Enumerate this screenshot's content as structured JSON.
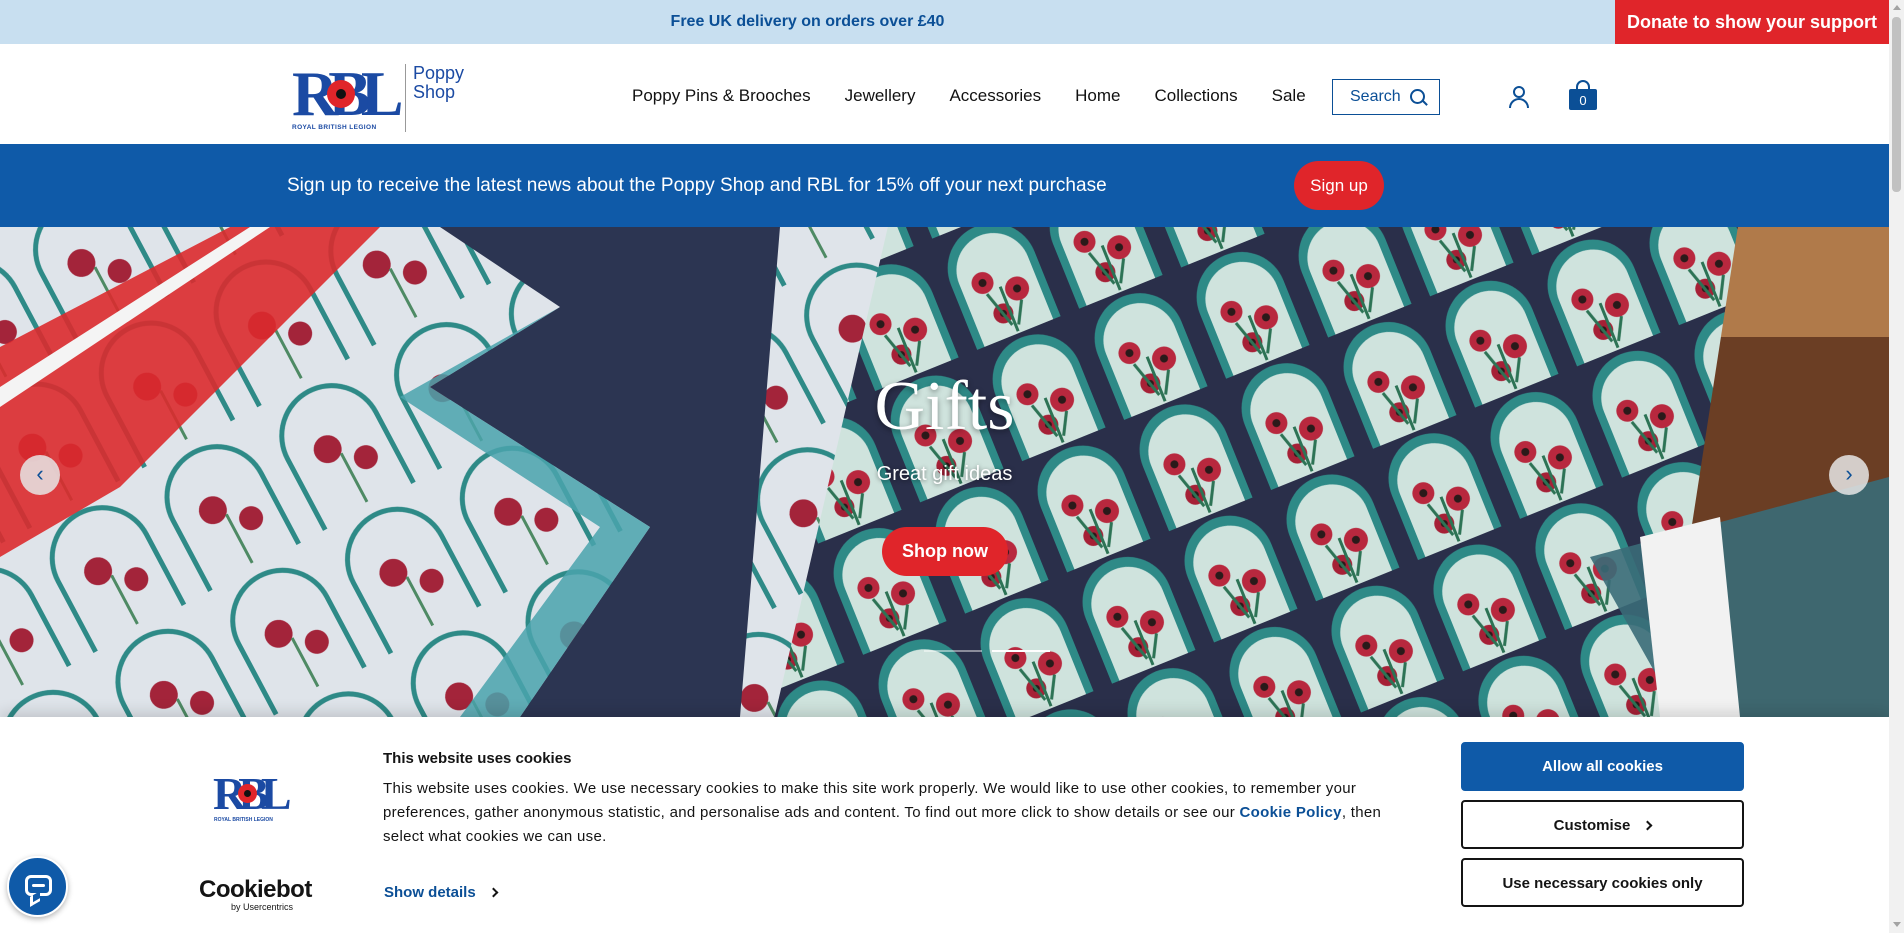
{
  "topbar": {
    "promo": "Free UK delivery on orders over £40",
    "donate": "Donate to show your support"
  },
  "logo": {
    "mark": "RBL",
    "org": "ROYAL BRITISH LEGION",
    "shop_line1": "Poppy",
    "shop_line2": "Shop"
  },
  "nav": {
    "items": [
      "Poppy Pins & Brooches",
      "Jewellery",
      "Accessories",
      "Home",
      "Collections",
      "Sale"
    ]
  },
  "search": {
    "label": "Search"
  },
  "cart": {
    "count": "0"
  },
  "signup": {
    "message": "Sign up to receive the latest news about the Poppy Shop and RBL for 15% off your next purchase",
    "button": "Sign up"
  },
  "hero": {
    "title": "Gifts",
    "subtitle": "Great gift ideas",
    "button": "Shop now",
    "prev": "‹",
    "next": "›",
    "slides": 2,
    "active_slide": 2
  },
  "cookie": {
    "logo_mark": "RBL",
    "logo_org": "ROYAL BRITISH LEGION",
    "title": "This website uses cookies",
    "text_before": "This website uses cookies. We use necessary cookies to make this site work properly. We would like to use other cookies, to remember your preferences, gather anonymous statistic, and personalise ads and content. To find out more click to show details or see our ",
    "policy_link": "Cookie Policy",
    "text_after": ", then select what cookies we can use.",
    "show_details": "Show details",
    "brand": "Cookiebot",
    "brand_sub": "by Usercentrics",
    "allow_all": "Allow all cookies",
    "customise": "Customise",
    "necessary_only": "Use necessary cookies only"
  },
  "colors": {
    "brand_blue": "#0f5aa8",
    "accent_red": "#e0252a",
    "topbar_bg": "#c8dff0"
  },
  "icons": {
    "search": "search-icon",
    "account": "user-icon",
    "cart": "shopping-bag-icon",
    "chat": "chat-bubble-icon"
  }
}
